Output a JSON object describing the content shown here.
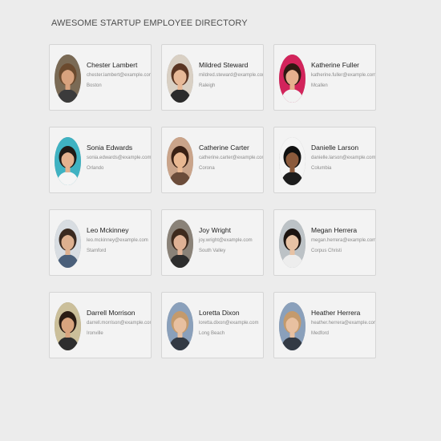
{
  "header": {
    "title": "AWESOME STARTUP EMPLOYEE DIRECTORY"
  },
  "employees": [
    {
      "name": "Chester Lambert",
      "email": "chester.lambert@example.com",
      "city": "Boston",
      "colors": {
        "bg": "#7a6a55",
        "skin": "#d8a27e",
        "hair": "#6b4a2e",
        "shirt": "#3b3b3b"
      }
    },
    {
      "name": "Mildred Steward",
      "email": "mildred.steward@example.com",
      "city": "Raleigh",
      "colors": {
        "bg": "#d9d0c4",
        "skin": "#e7b998",
        "hair": "#5a3522",
        "shirt": "#2b2b2b"
      }
    },
    {
      "name": "Katherine Fuller",
      "email": "katherine.fuller@example.com",
      "city": "Mcallen",
      "colors": {
        "bg": "#d2245b",
        "skin": "#e6b08e",
        "hair": "#2e1a12",
        "shirt": "#f2f2f2"
      }
    },
    {
      "name": "Sonia Edwards",
      "email": "sonia.edwards@example.com",
      "city": "Orlando",
      "colors": {
        "bg": "#3fb2c2",
        "skin": "#e4b18f",
        "hair": "#1f1a17",
        "shirt": "#f5f5f5"
      }
    },
    {
      "name": "Catherine Carter",
      "email": "catherine.carter@example.com",
      "city": "Corona",
      "colors": {
        "bg": "#caa48a",
        "skin": "#e9b892",
        "hair": "#3a2115",
        "shirt": "#6b4c3a"
      }
    },
    {
      "name": "Danielle Larson",
      "email": "danielle.larson@example.com",
      "city": "Columbia",
      "colors": {
        "bg": "#f4f4f4",
        "skin": "#8b5a3c",
        "hair": "#101010",
        "shirt": "#1c1c1c"
      }
    },
    {
      "name": "Leo Mckinney",
      "email": "leo.mckinney@example.com",
      "city": "Stamford",
      "colors": {
        "bg": "#d8dde2",
        "skin": "#ddb08f",
        "hair": "#3a2a20",
        "shirt": "#4a5f7a"
      }
    },
    {
      "name": "Joy Wright",
      "email": "joy.wright@example.com",
      "city": "South Valley",
      "colors": {
        "bg": "#8a8278",
        "skin": "#e0b295",
        "hair": "#3e2a1d",
        "shirt": "#2d2d2d"
      }
    },
    {
      "name": "Megan Herrera",
      "email": "megan.herrera@example.com",
      "city": "Corpus Christi",
      "colors": {
        "bg": "#bcc2c6",
        "skin": "#e7c2a4",
        "hair": "#1c1410",
        "shirt": "#ededed"
      }
    },
    {
      "name": "Darrell Morrison",
      "email": "darrell.morrison@example.com",
      "city": "Ironville",
      "colors": {
        "bg": "#cbbf9a",
        "skin": "#d9a47e",
        "hair": "#2a1c14",
        "shirt": "#2e2e2e"
      }
    },
    {
      "name": "Loretta Dixon",
      "email": "loretta.dixon@example.com",
      "city": "Long Beach",
      "colors": {
        "bg": "#8aa0bb",
        "skin": "#e8c0a0",
        "hair": "#c49a6c",
        "shirt": "#333a44"
      }
    },
    {
      "name": "Heather Herrera",
      "email": "heather.herrera@example.com",
      "city": "Medford",
      "colors": {
        "bg": "#8aa0bb",
        "skin": "#e8c0a0",
        "hair": "#c49a6c",
        "shirt": "#333a44"
      }
    }
  ]
}
